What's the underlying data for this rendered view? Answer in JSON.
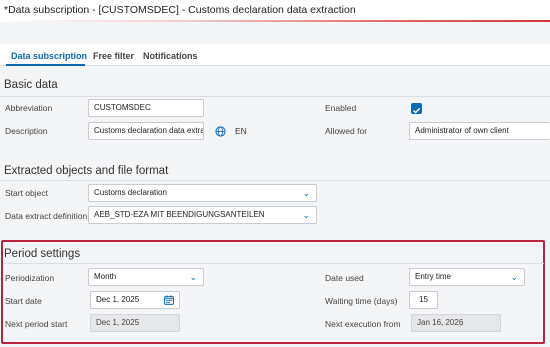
{
  "window": {
    "title": "*Data subscription - [CUSTOMSDEC] - Customs declaration data extraction"
  },
  "tabs": [
    {
      "label": "Data subscription"
    },
    {
      "label": "Free filter"
    },
    {
      "label": "Notifications"
    }
  ],
  "basic": {
    "title": "Basic data",
    "abbreviation_label": "Abbreviation",
    "abbreviation_value": "CUSTOMSDEC",
    "description_label": "Description",
    "description_value": "Customs declaration data extrac",
    "language": "EN",
    "enabled_label": "Enabled",
    "allowed_label": "Allowed for",
    "allowed_value": "Administrator of own client"
  },
  "extract": {
    "title": "Extracted objects and file format",
    "start_label": "Start object",
    "start_value": "Customs declaration",
    "definition_label": "Data extract definition",
    "definition_value": "AEB_STD-EZA MIT BEENDIGUNGSANTEILEN"
  },
  "period": {
    "title": "Period settings",
    "periodization_label": "Periodization",
    "periodization_value": "Month",
    "date_used_label": "Date used",
    "date_used_value": "Entry time",
    "start_date_label": "Start date",
    "start_date_value": "Dec 1, 2025",
    "waiting_label": "Waiting time (days)",
    "waiting_value": "15",
    "next_start_label": "Next period start",
    "next_start_value": "Dec 1, 2025",
    "next_exec_label": "Next execution from",
    "next_exec_value": "Jan 16, 2026"
  },
  "icons": {
    "chevron": "chevron-down-icon",
    "globe": "globe-icon",
    "calendar": "calendar-icon",
    "check": "check-icon"
  },
  "colors": {
    "accent": "#0a6ab3",
    "highlight_border": "#b6243e",
    "title_gradient": "#d23a3a"
  }
}
